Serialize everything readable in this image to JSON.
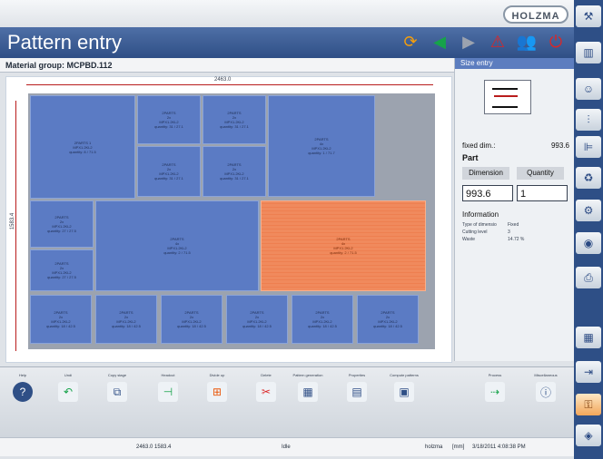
{
  "brand": {
    "logo": "HOLZMA"
  },
  "title": "Pattern entry",
  "title_icons": [
    {
      "name": "refresh-icon",
      "glyph": "⟳",
      "color": "#f59e0b"
    },
    {
      "name": "back-arrow-icon",
      "glyph": "◀",
      "color": "#16a34a"
    },
    {
      "name": "forward-arrow-icon",
      "glyph": "▶",
      "color": "#9ca3af"
    },
    {
      "name": "warning-icon",
      "glyph": "⚠",
      "color": "#dc2626"
    },
    {
      "name": "operator-icon",
      "glyph": "👥",
      "color": "#ffffff"
    },
    {
      "name": "stop-icon",
      "glyph": "⏻",
      "color": "#dc2626"
    }
  ],
  "material_group": "Material group: MCPBD.112",
  "canvas": {
    "width_label": "2463.0",
    "height_label": "1583.4"
  },
  "pieces": [
    {
      "label": "2PARTS 1\nMPX1.2KL2\nquantity: 8 / 71.5"
    },
    {
      "label": "2PARTS\n2x\nMPX1.2KL2\nquantity: 31 / 27.1"
    },
    {
      "label": "2PARTS\n2x\nMPX1.2KL2\nquantity: 31 / 27.1"
    },
    {
      "label": "2PARTS\n2x\nMPX1.2KL2\nquantity: 31 / 27.1"
    },
    {
      "label": "2PARTS\n2x\nMPX1.2KL2\nquantity: 31 / 27.1"
    },
    {
      "label": "2PARTS\n4x\nMPX1.2KL2\nquantity: 1 / 71.7"
    },
    {
      "label": "2PARTS\n2x\nMPX1.2KL2\nquantity: 27 / 27.5"
    },
    {
      "label": "2PARTS\n2x\nMPX1.2KL2\nquantity: 27 / 27.5"
    },
    {
      "label": "2PARTS\n4x\nMPX1.2KL2\nquantity: 2 / 71.5"
    },
    {
      "label": "2PARTS\n4x\nMPX1.2KL2\nquantity: 2 / 71.5"
    },
    {
      "label": "2PARTS\n2x\nMPX1.2KL2\nquantity: 18 / 42.5"
    },
    {
      "label": "2PARTS\n2x\nMPX1.2KL2\nquantity: 18 / 42.5"
    },
    {
      "label": "2PARTS\n2x\nMPX1.2KL2\nquantity: 18 / 42.5"
    },
    {
      "label": "2PARTS\n2x\nMPX1.2KL2\nquantity: 18 / 42.5"
    },
    {
      "label": "2PARTS\n2x\nMPX1.2KL2\nquantity: 18 / 42.5"
    },
    {
      "label": "2PARTS\n2x\nMPX1.2KL2\nquantity: 18 / 42.5"
    }
  ],
  "panel": {
    "header": "Size entry",
    "fixed_dim_label": "fixed dim.:",
    "fixed_dim_value": "993.6",
    "part_label": "Part",
    "dimension_header": "Dimension",
    "quantity_header": "Quantity",
    "dimension_value": "993.6",
    "quantity_value": "1",
    "information_label": "Information",
    "info": [
      {
        "key": "Type of dimensio",
        "value": "Fixed"
      },
      {
        "key": "Cutting level",
        "value": "3"
      },
      {
        "key": "Waste",
        "value": "14.72 %"
      }
    ]
  },
  "toolbar": [
    {
      "label": "Help",
      "icon": "help-icon",
      "glyph": "?",
      "color": "#2f4f86"
    },
    {
      "label": "Undi",
      "icon": "undo-icon",
      "glyph": "↶",
      "color": "#16a34a"
    },
    {
      "label": "Copy stage",
      "icon": "copy-stage-icon",
      "glyph": "⧉",
      "color": "#2f4f86"
    },
    {
      "label": "Headcut",
      "icon": "headcut-icon",
      "glyph": "⊣",
      "color": "#16a34a"
    },
    {
      "label": "Divide up",
      "icon": "divide-icon",
      "glyph": "⊞",
      "color": "#ea580c"
    },
    {
      "label": "Delete",
      "icon": "delete-icon",
      "glyph": "✂",
      "color": "#dc2626"
    },
    {
      "label": "Pattern generation",
      "icon": "pattern-icon",
      "glyph": "▦",
      "color": "#2f4f86"
    },
    {
      "label": "Properties",
      "icon": "properties-icon",
      "glyph": "▤",
      "color": "#2f4f86"
    },
    {
      "label": "Compute patterns",
      "icon": "compute-icon",
      "glyph": "▣",
      "color": "#2f4f86"
    },
    {
      "label": "Process",
      "icon": "process-icon",
      "glyph": "⇢",
      "color": "#16a34a"
    },
    {
      "label": "Miscellaneous",
      "icon": "misc-icon",
      "glyph": "ⓘ",
      "color": "#2f4f86"
    }
  ],
  "status": {
    "coords": "2463.0 1583.4",
    "mode": "Idle",
    "user": "holzma",
    "unit": "[mm]",
    "datetime": "3/18/2011 4:08:38 PM"
  },
  "sidebar_icons": [
    {
      "name": "tool-icon",
      "glyph": "⚒"
    },
    {
      "name": "pattern-icon",
      "glyph": "▥"
    },
    {
      "name": "operator-icon",
      "glyph": "☺"
    },
    {
      "name": "saw-icon",
      "glyph": "⫶"
    },
    {
      "name": "stack-icon",
      "glyph": "⊫"
    },
    {
      "name": "trash-icon",
      "glyph": "♻"
    },
    {
      "name": "settings-icon",
      "glyph": "⚙"
    },
    {
      "name": "timer-icon",
      "glyph": "◉"
    },
    {
      "name": "print-icon",
      "glyph": "⎙"
    },
    {
      "name": "grid-icon",
      "glyph": "▦"
    },
    {
      "name": "exit-icon",
      "glyph": "⇥"
    },
    {
      "name": "tools-icon",
      "glyph": "⚿"
    },
    {
      "name": "layers-icon",
      "glyph": "◈"
    }
  ]
}
